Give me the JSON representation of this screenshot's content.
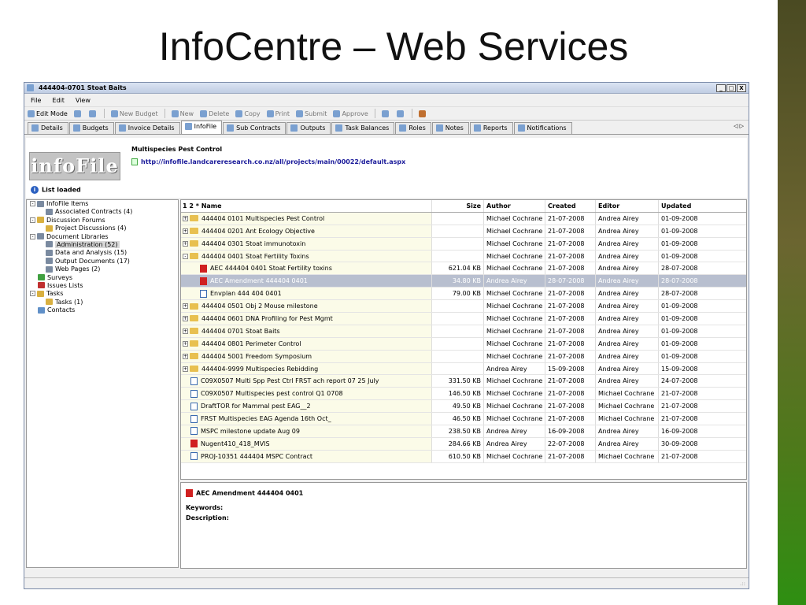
{
  "slide": {
    "title": "InfoCentre – Web Services"
  },
  "window": {
    "title": "444404-0701 Stoat Baits",
    "min": "_",
    "max": "□",
    "close": "X"
  },
  "menu": [
    "File",
    "Edit",
    "View"
  ],
  "toolbar": {
    "edit_mode": "Edit Mode",
    "new_budget": "New Budget",
    "new": "New",
    "delete": "Delete",
    "copy": "Copy",
    "print": "Print",
    "submit": "Submit",
    "approve": "Approve"
  },
  "tabs": [
    "Details",
    "Budgets",
    "Invoice Details",
    "InfoFile",
    "Sub Contracts",
    "Outputs",
    "Task Balances",
    "Roles",
    "Notes",
    "Reports",
    "Notifications"
  ],
  "tab_arrows": "◁ ▷",
  "header": {
    "logo_text": "infoFile",
    "project_title": "Multispecies Pest Control",
    "url": "http://infofile.landcareresearch.co.nz/all/projects/main/00022/default.aspx",
    "status": "List loaded"
  },
  "tree": [
    {
      "label": "InfoFile Items",
      "depth": 0,
      "exp": "-",
      "icon": "lib"
    },
    {
      "label": "Associated Contracts (4)",
      "depth": 2,
      "icon": "lib"
    },
    {
      "label": "Discussion Forums",
      "depth": 0,
      "exp": "-",
      "icon": "yel"
    },
    {
      "label": "Project Discussions (4)",
      "depth": 2,
      "icon": "yel"
    },
    {
      "label": "Document Libraries",
      "depth": 0,
      "exp": "-",
      "icon": "lib"
    },
    {
      "label": "Administration (52)",
      "depth": 2,
      "icon": "lib",
      "selected": true
    },
    {
      "label": "Data and Analysis (15)",
      "depth": 2,
      "icon": "lib"
    },
    {
      "label": "Output Documents (17)",
      "depth": 2,
      "icon": "lib"
    },
    {
      "label": "Web Pages (2)",
      "depth": 2,
      "icon": "lib"
    },
    {
      "label": "Surveys",
      "depth": 1,
      "icon": "grn"
    },
    {
      "label": "Issues Lists",
      "depth": 1,
      "icon": "red"
    },
    {
      "label": "Tasks",
      "depth": 0,
      "exp": "-",
      "icon": "yel"
    },
    {
      "label": "Tasks (1)",
      "depth": 2,
      "icon": "yel"
    },
    {
      "label": "Contacts",
      "depth": 1,
      "icon": "blu"
    }
  ],
  "grid": {
    "headers": {
      "sort": "1 2 *",
      "name": "Name",
      "size": "Size",
      "author": "Author",
      "created": "Created",
      "editor": "Editor",
      "updated": "Updated"
    },
    "rows": [
      {
        "type": "folder",
        "exp": "+",
        "name": "444404 0101   Multispecies Pest Control",
        "size": "",
        "author": "Michael Cochrane",
        "created": "21-07-2008",
        "editor": "Andrea Airey",
        "updated": "01-09-2008"
      },
      {
        "type": "folder",
        "exp": "+",
        "name": "444404 0201   Ant Ecology Objective",
        "size": "",
        "author": "Michael Cochrane",
        "created": "21-07-2008",
        "editor": "Andrea Airey",
        "updated": "01-09-2008"
      },
      {
        "type": "folder",
        "exp": "+",
        "name": "444404 0301   Stoat immunotoxin",
        "size": "",
        "author": "Michael Cochrane",
        "created": "21-07-2008",
        "editor": "Andrea Airey",
        "updated": "01-09-2008"
      },
      {
        "type": "folder",
        "exp": "-",
        "name": "444404 0401   Stoat Fertility Toxins",
        "size": "",
        "author": "Michael Cochrane",
        "created": "21-07-2008",
        "editor": "Andrea Airey",
        "updated": "01-09-2008"
      },
      {
        "type": "pdf",
        "child": true,
        "name": "AEC 444404 0401 Stoat Fertility toxins",
        "size": "621.04 KB",
        "author": "Michael Cochrane",
        "created": "21-07-2008",
        "editor": "Andrea Airey",
        "updated": "28-07-2008"
      },
      {
        "type": "pdf",
        "child": true,
        "selected": true,
        "name": "AEC Amendment 444404 0401",
        "size": "34.80 KB",
        "author": "Andrea Airey",
        "created": "28-07-2008",
        "editor": "Andrea Airey",
        "updated": "28-07-2008"
      },
      {
        "type": "doc",
        "child": true,
        "name": "Envplan 444 404 0401",
        "size": "79.00 KB",
        "author": "Michael Cochrane",
        "created": "21-07-2008",
        "editor": "Andrea Airey",
        "updated": "28-07-2008"
      },
      {
        "type": "folder",
        "exp": "+",
        "name": "444404 0501   Obj 2 Mouse milestone",
        "size": "",
        "author": "Michael Cochrane",
        "created": "21-07-2008",
        "editor": "Andrea Airey",
        "updated": "01-09-2008"
      },
      {
        "type": "folder",
        "exp": "+",
        "name": "444404 0601   DNA Profiling for Pest Mgmt",
        "size": "",
        "author": "Michael Cochrane",
        "created": "21-07-2008",
        "editor": "Andrea Airey",
        "updated": "01-09-2008"
      },
      {
        "type": "folder",
        "exp": "+",
        "name": "444404 0701   Stoat Baits",
        "size": "",
        "author": "Michael Cochrane",
        "created": "21-07-2008",
        "editor": "Andrea Airey",
        "updated": "01-09-2008"
      },
      {
        "type": "folder",
        "exp": "+",
        "name": "444404 0801   Perimeter Control",
        "size": "",
        "author": "Michael Cochrane",
        "created": "21-07-2008",
        "editor": "Andrea Airey",
        "updated": "01-09-2008"
      },
      {
        "type": "folder",
        "exp": "+",
        "name": "444404 5001   Freedom Symposium",
        "size": "",
        "author": "Michael Cochrane",
        "created": "21-07-2008",
        "editor": "Andrea Airey",
        "updated": "01-09-2008"
      },
      {
        "type": "folder",
        "exp": "+",
        "name": "444404-9999 Multispecies Rebidding",
        "size": "",
        "author": "Andrea Airey",
        "created": "15-09-2008",
        "editor": "Andrea Airey",
        "updated": "15-09-2008"
      },
      {
        "type": "doc",
        "name": "C09X0507 Multi Spp Pest Ctrl FRST ach report 07 25 July",
        "size": "331.50 KB",
        "author": "Michael Cochrane",
        "created": "21-07-2008",
        "editor": "Andrea Airey",
        "updated": "24-07-2008"
      },
      {
        "type": "doc",
        "name": "C09X0507 Multispecies pest control Q1 0708",
        "size": "146.50 KB",
        "author": "Michael Cochrane",
        "created": "21-07-2008",
        "editor": "Michael Cochrane",
        "updated": "21-07-2008"
      },
      {
        "type": "doc",
        "name": "DraftTOR for Mammal pest EAG__2",
        "size": "49.50 KB",
        "author": "Michael Cochrane",
        "created": "21-07-2008",
        "editor": "Michael Cochrane",
        "updated": "21-07-2008"
      },
      {
        "type": "doc",
        "name": "FRST Multispecies EAG Agenda 16th Oct_",
        "size": "46.50 KB",
        "author": "Michael Cochrane",
        "created": "21-07-2008",
        "editor": "Michael Cochrane",
        "updated": "21-07-2008"
      },
      {
        "type": "doc",
        "name": "MSPC milestone update Aug 09",
        "size": "238.50 KB",
        "author": "Andrea Airey",
        "created": "16-09-2008",
        "editor": "Andrea Airey",
        "updated": "16-09-2008"
      },
      {
        "type": "pdf",
        "name": "Nugent410_418_MVIS",
        "size": "284.66 KB",
        "author": "Andrea Airey",
        "created": "22-07-2008",
        "editor": "Andrea Airey",
        "updated": "30-09-2008"
      },
      {
        "type": "doc",
        "name": "PROJ-10351  444404 MSPC  Contract",
        "size": "610.50 KB",
        "author": "Michael Cochrane",
        "created": "21-07-2008",
        "editor": "Michael Cochrane",
        "updated": "21-07-2008"
      }
    ]
  },
  "preview": {
    "title": "AEC Amendment 444404 0401",
    "keywords_label": "Keywords:",
    "description_label": "Description:"
  },
  "statusbar": {
    "grip": ".::"
  }
}
